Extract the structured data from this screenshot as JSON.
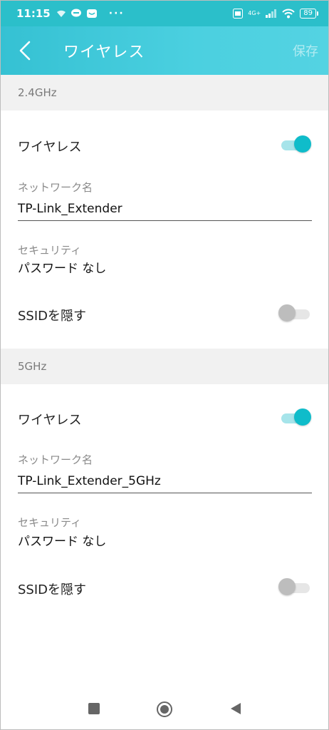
{
  "status_bar": {
    "time": "11:15",
    "more": "···",
    "network": "4G+",
    "battery": "89"
  },
  "app_bar": {
    "title": "ワイヤレス",
    "save_label": "保存"
  },
  "bands": [
    {
      "header": "2.4GHz",
      "wireless_label": "ワイヤレス",
      "wireless_enabled": true,
      "network_name_label": "ネットワーク名",
      "network_name_value": "TP-Link_Extender",
      "security_label": "セキュリティ",
      "security_value": "パスワード なし",
      "hide_ssid_label": "SSIDを隠す",
      "hide_ssid_enabled": false
    },
    {
      "header": "5GHz",
      "wireless_label": "ワイヤレス",
      "wireless_enabled": true,
      "network_name_label": "ネットワーク名",
      "network_name_value": "TP-Link_Extender_5GHz",
      "security_label": "セキュリティ",
      "security_value": "パスワード なし",
      "hide_ssid_label": "SSIDを隠す",
      "hide_ssid_enabled": false
    }
  ],
  "colors": {
    "app_bar": "#3ec6d8",
    "accent": "#0fbcca"
  }
}
